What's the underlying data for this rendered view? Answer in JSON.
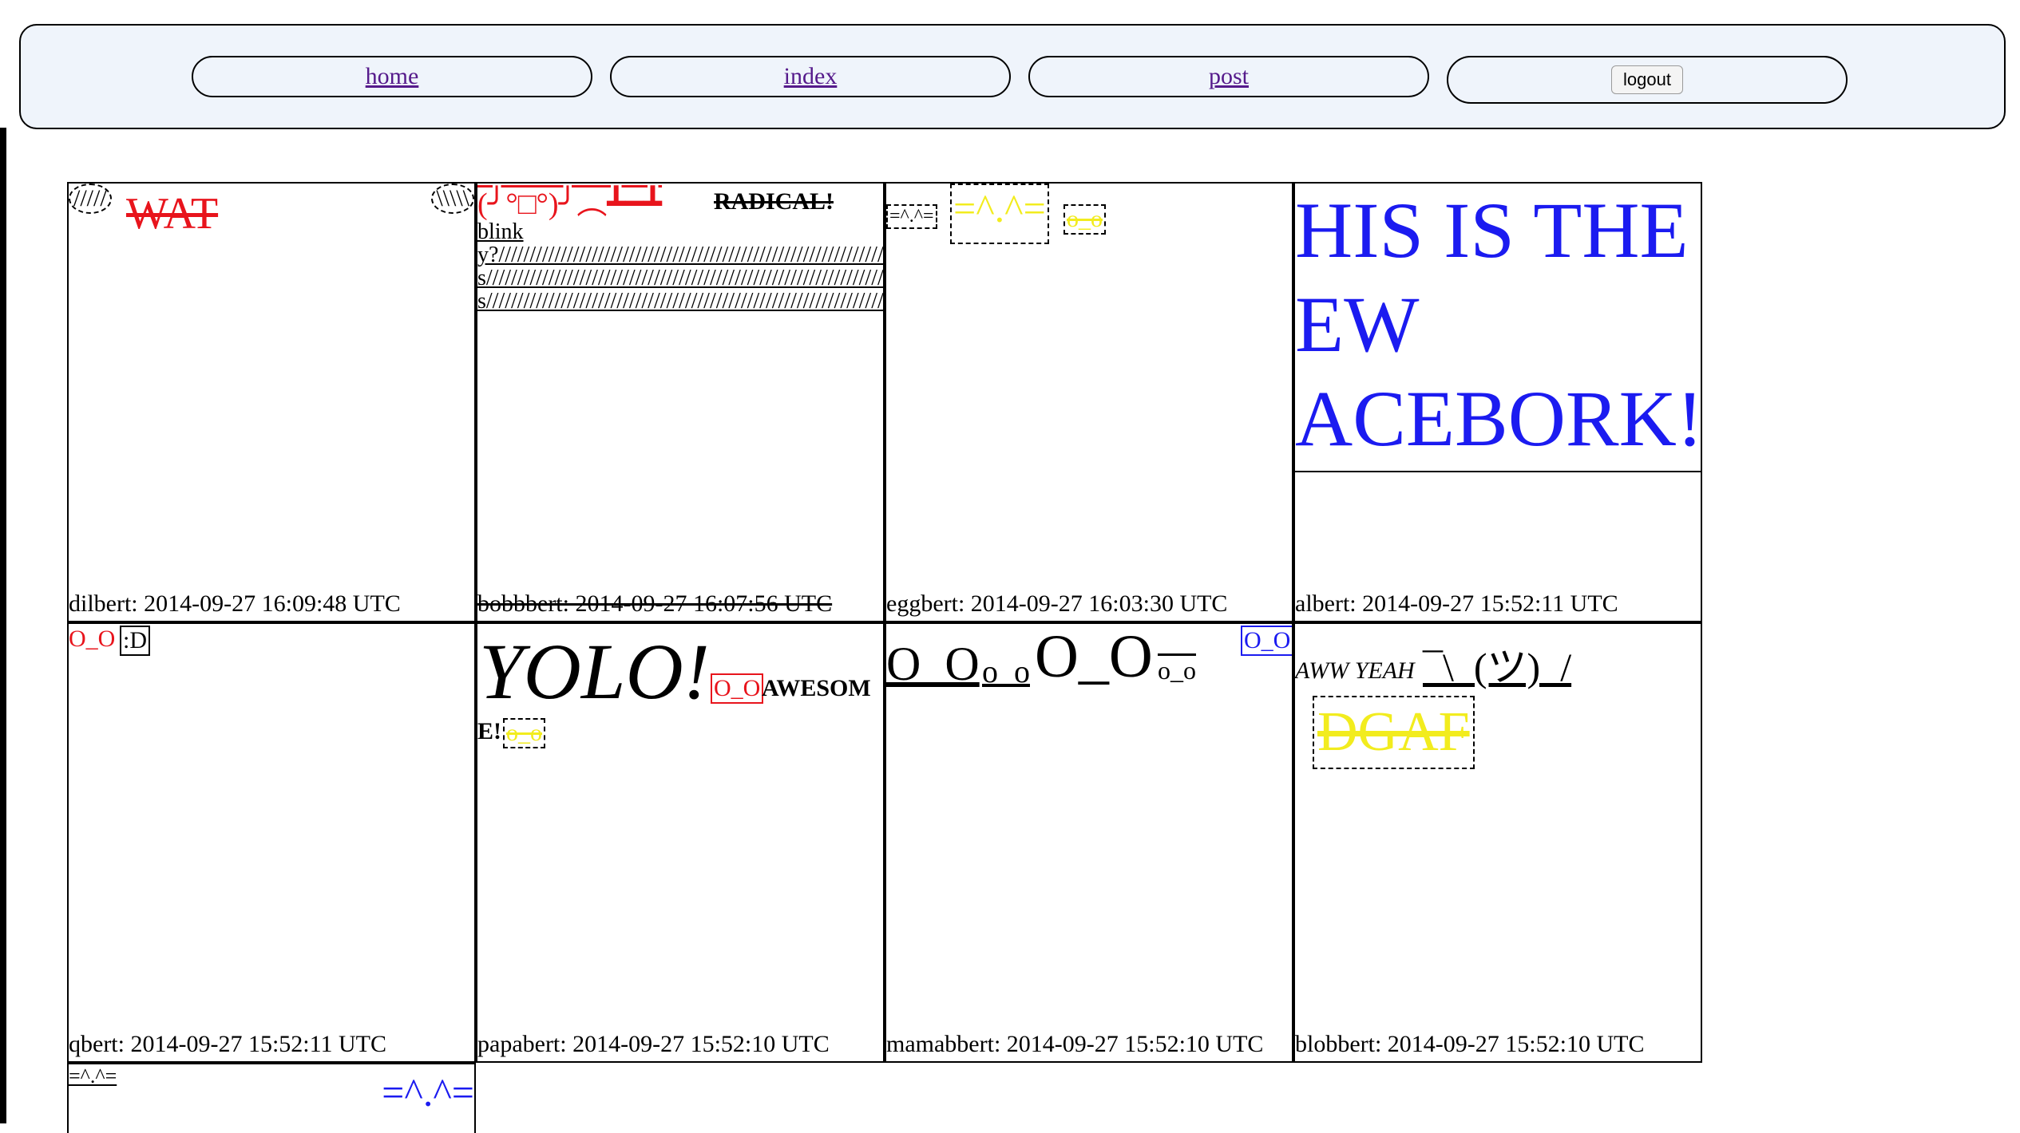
{
  "nav": {
    "home": "home",
    "index": "index",
    "post": "post",
    "logout": "logout"
  },
  "posts": [
    {
      "id": "dilbert",
      "meta": "dilbert: 2014-09-27 16:09:48 UTC",
      "left_oval": "/////",
      "title": "WAT",
      "right_oval": "\\\\\\\\\\"
    },
    {
      "id": "bobbbert",
      "meta": "bobbbert: 2014-09-27 16:07:56 UTC",
      "flip": "(╯°□°)╯︵┻━┻",
      "radical": "RADICAL!",
      "body": "blinky?////////////////////////////////////////////////////////////////////////////////////////////////////////////////////////////////////////////////////////////////////////////////////////////////////////////////////////////////s/////////////////////////////////////////////////////////////////////////////////////////////////////////////////////////////////////////////////////s/////////////////////////////////////////////////////////////////////////////////////////////////////////////////////////////////////////////////////////////////////////////////"
    },
    {
      "id": "eggbert",
      "meta": "eggbert: 2014-09-27 16:03:30 UTC",
      "small_cat": "=^.^=",
      "big_cat": "=^.^=",
      "oo": "o_o"
    },
    {
      "id": "albert",
      "meta": "albert: 2014-09-27 15:52:11 UTC",
      "line1": "HIS IS THE",
      "line2": "EW",
      "line3": "ACEBORK!"
    },
    {
      "id": "qbert",
      "meta": "qbert: 2014-09-27 15:52:11 UTC",
      "oo": "O_O",
      "smile": ":D"
    },
    {
      "id": "papabert",
      "meta": "papabert: 2014-09-27 15:52:10 UTC",
      "yolo": "YOLO!",
      "oo": "O_O",
      "awesome1": "AWESOM",
      "awesome2": "E!",
      "oo2": "o_o"
    },
    {
      "id": "mamabbert",
      "meta": "mamabbert: 2014-09-27 15:52:10 UTC",
      "o1": "O_O",
      "o2": "o_o",
      "o3": "O_O",
      "o4": "o_o",
      "o5": "O_O"
    },
    {
      "id": "blobbert",
      "meta": "blobbert: 2014-09-27 15:52:10 UTC",
      "aww": "AWW YEAH",
      "shrug": "¯\\_(ツ)_/",
      "dgaf": "DGAF"
    },
    {
      "id": "unknown",
      "small_cat": "=^.^=",
      "big_cat": "=^.^="
    }
  ]
}
